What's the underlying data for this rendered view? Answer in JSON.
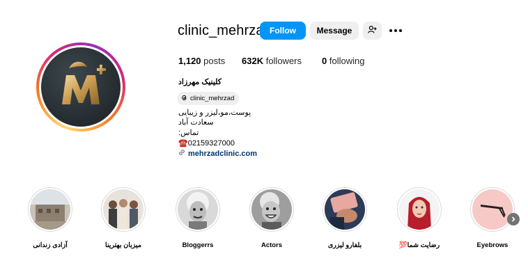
{
  "profile": {
    "username": "clinic_mehrzad",
    "follow_label": "Follow",
    "message_label": "Message",
    "suggest_icon": "person-add-icon",
    "more_icon": "more-horizontal-icon"
  },
  "stats": {
    "posts_count": "1,120",
    "posts_label": "posts",
    "followers_count": "632K",
    "followers_label": "followers",
    "following_count": "0",
    "following_label": "following"
  },
  "bio": {
    "name": "کلینیک مهرزاد",
    "threads_handle": "clinic_mehrzad",
    "lines": [
      "پوست،مو،لیزر و زیبایی",
      "سعادت آباد",
      "تماس:",
      "☎️02159327000"
    ],
    "link": "mehrzadclinic.com"
  },
  "highlights": [
    {
      "label": "آزادی زندانی",
      "thumb": "building-photo"
    },
    {
      "label": "میزبان بهترینا",
      "thumb": "group-photo"
    },
    {
      "label": "Bloggerrs",
      "thumb": "portrait-bw"
    },
    {
      "label": "Actors",
      "thumb": "portrait-bw-smile"
    },
    {
      "label": "بلفارو لیزری",
      "thumb": "hand-photo"
    },
    {
      "label": "رضایت شما💯",
      "thumb": "woman-red-scarf"
    },
    {
      "label": "Eyebrows",
      "thumb": "tweezers-on-pink"
    }
  ],
  "colors": {
    "accent": "#0095f6",
    "link": "#00376b",
    "secondary_button": "#efefef"
  }
}
